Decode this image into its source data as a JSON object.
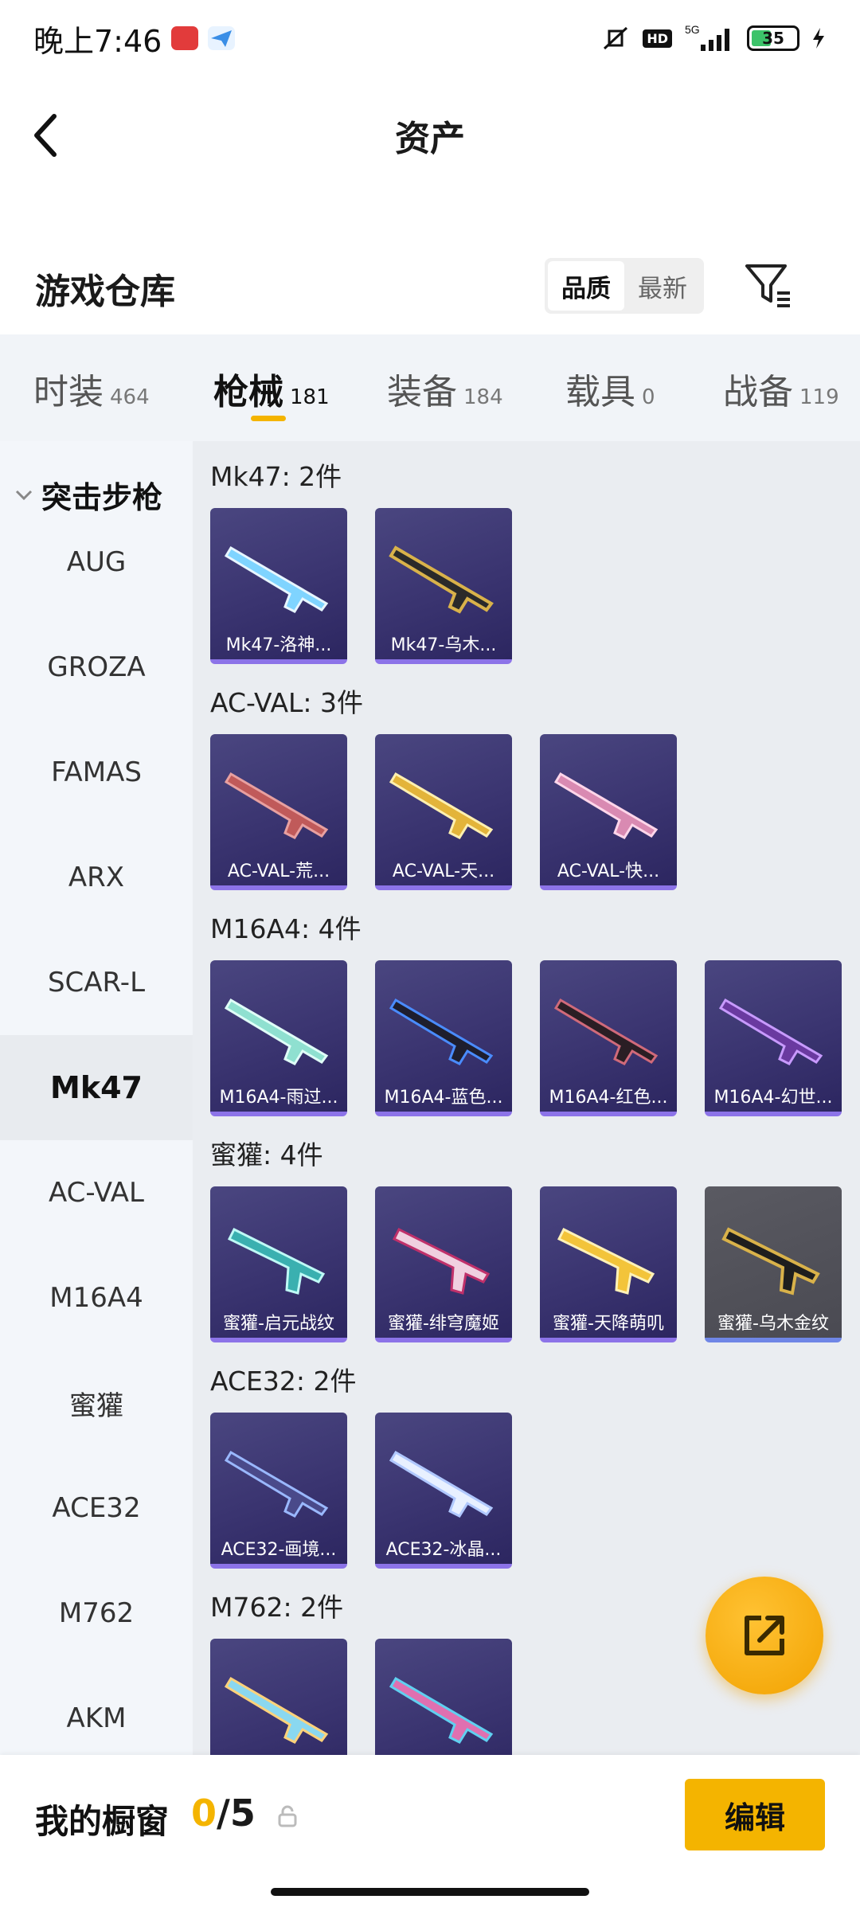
{
  "status_bar": {
    "time": "晚上7:46",
    "network": "5G",
    "hd": "HD",
    "battery": "35"
  },
  "header": {
    "title": "资产"
  },
  "warehouse": {
    "title": "游戏仓库",
    "sort_options": [
      "品质",
      "最新"
    ],
    "active_sort": "品质"
  },
  "tabs": [
    {
      "label": "时装",
      "count": "464"
    },
    {
      "label": "枪械",
      "count": "181"
    },
    {
      "label": "装备",
      "count": "184"
    },
    {
      "label": "载具",
      "count": "0"
    },
    {
      "label": "战备",
      "count": "119"
    }
  ],
  "sidebar": {
    "header": "突击步枪",
    "items": [
      "AUG",
      "GROZA",
      "FAMAS",
      "ARX",
      "SCAR-L",
      "Mk47",
      "AC-VAL",
      "M16A4",
      "蜜獾",
      "ACE32",
      "M762",
      "AKM"
    ],
    "active": "Mk47"
  },
  "groups": [
    {
      "title": "Mk47: 2件",
      "items": [
        "Mk47-洛神...",
        "Mk47-乌木..."
      ]
    },
    {
      "title": "AC-VAL: 3件",
      "items": [
        "AC-VAL-荒...",
        "AC-VAL-天...",
        "AC-VAL-快..."
      ]
    },
    {
      "title": "M16A4: 4件",
      "items": [
        "M16A4-雨过...",
        "M16A4-蓝色...",
        "M16A4-红色...",
        "M16A4-幻世..."
      ]
    },
    {
      "title": "蜜獾: 4件",
      "items": [
        "蜜獾-启元战纹",
        "蜜獾-绯穹魔姬",
        "蜜獾-天降萌叽",
        "蜜獾-乌木金纹"
      ]
    },
    {
      "title": "ACE32: 2件",
      "items": [
        "ACE32-画境...",
        "ACE32-冰晶..."
      ]
    },
    {
      "title": "M762: 2件",
      "items": [
        "",
        ""
      ]
    }
  ],
  "showcase": {
    "label": "我的橱窗",
    "current": "0",
    "total": "/5",
    "edit_label": "编辑"
  },
  "colors": {
    "accent": "#f4b400",
    "card_bg": "#3a3470",
    "card_border": "#8c73e8"
  },
  "icons": {
    "back": "chevron-left-icon",
    "filter": "filter-icon",
    "lock": "lock-icon",
    "share": "share-external-icon"
  }
}
